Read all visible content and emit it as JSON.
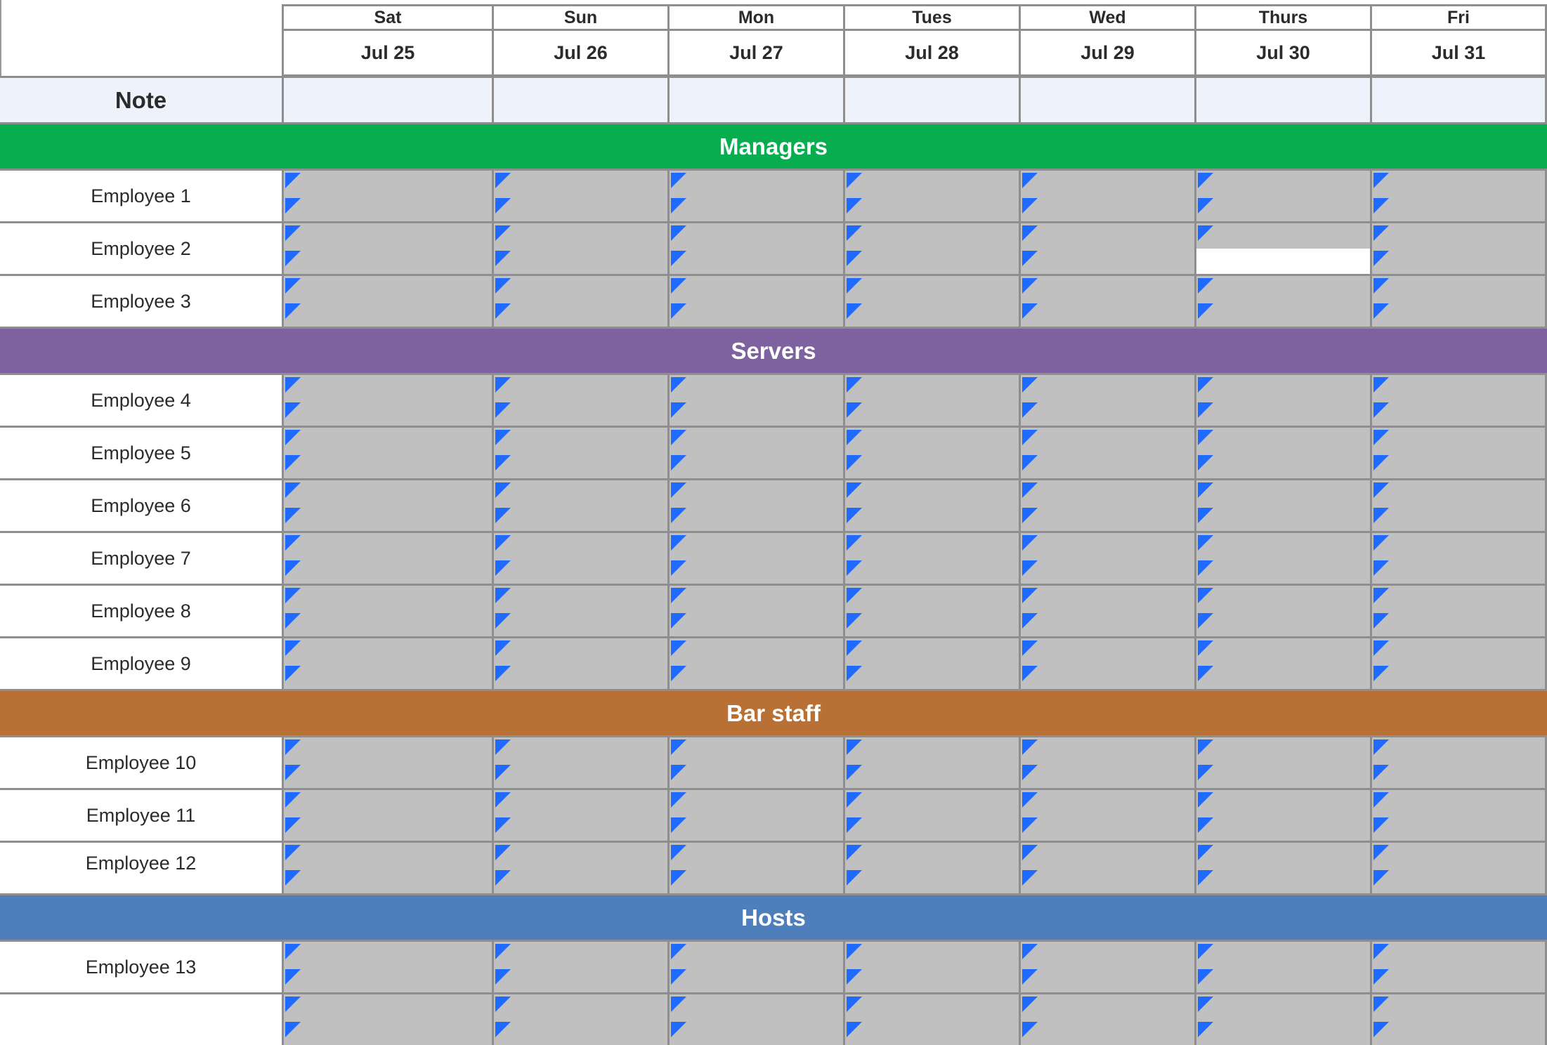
{
  "days": [
    {
      "day": "Sat",
      "date": "Jul 25"
    },
    {
      "day": "Sun",
      "date": "Jul 26"
    },
    {
      "day": "Mon",
      "date": "Jul 27"
    },
    {
      "day": "Tues",
      "date": "Jul 28"
    },
    {
      "day": "Wed",
      "date": "Jul 29"
    },
    {
      "day": "Thurs",
      "date": "Jul 30"
    },
    {
      "day": "Fri",
      "date": "Jul 31"
    }
  ],
  "note": {
    "label": "Note",
    "values": [
      "",
      "",
      "",
      "",
      "",
      "",
      ""
    ]
  },
  "colors": {
    "cell_background": "#c0c0c0",
    "note_background": "#eef3fb",
    "marker": "#1f6bff",
    "grid": "#8e8e8e"
  },
  "groups": [
    {
      "name": "Managers",
      "color": "#08ad4f",
      "employees": [
        {
          "name": "Employee 1"
        },
        {
          "name": "Employee 2",
          "empty_slots": [
            {
              "day": 5,
              "slot": 1
            }
          ]
        },
        {
          "name": "Employee 3"
        }
      ]
    },
    {
      "name": "Servers",
      "color": "#7e62a0",
      "employees": [
        {
          "name": "Employee 4"
        },
        {
          "name": "Employee 5"
        },
        {
          "name": "Employee 6"
        },
        {
          "name": "Employee 7"
        },
        {
          "name": "Employee 8"
        },
        {
          "name": "Employee 9"
        }
      ]
    },
    {
      "name": "Bar staff",
      "color": "#b87034",
      "employees": [
        {
          "name": "Employee 10"
        },
        {
          "name": "Employee 11"
        },
        {
          "name": "Employee 12",
          "top_aligned": true
        }
      ]
    },
    {
      "name": "Hosts",
      "color": "#4f7fba",
      "employees": [
        {
          "name": "Employee 13"
        },
        {
          "name": ""
        }
      ]
    }
  ]
}
